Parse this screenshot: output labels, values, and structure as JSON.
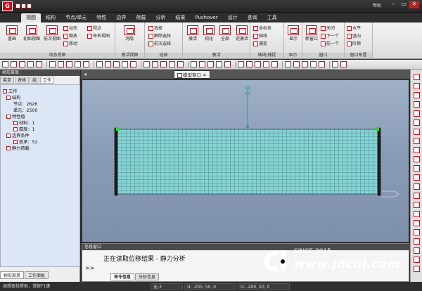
{
  "app": {
    "logo_text": "G",
    "help_label": "帮助",
    "menu_tabs": [
      "视图",
      "结构",
      "节点/单元",
      "特性",
      "边界",
      "荷载",
      "分析",
      "结果",
      "Pushover",
      "设计",
      "查询",
      "工具"
    ],
    "window_buttons": [
      "–",
      "▭",
      "✕"
    ]
  },
  "ribbon": {
    "groups": [
      {
        "label": "动态视图",
        "buttons": [
          "重画",
          "初始视图",
          "前次视图"
        ],
        "small": [
          "动态",
          "缩放",
          "移动",
          "视点",
          "命名视图"
        ]
      },
      {
        "label": "激活视图",
        "buttons": [
          "消隐"
        ]
      },
      {
        "label": "选择",
        "small": [
          "选择",
          "解除选择",
          "前次选择"
        ]
      },
      {
        "label": "激活",
        "buttons": [
          "激活",
          "钝化",
          "全部",
          "逆激活"
        ]
      },
      {
        "label": "轴线/捕捉",
        "small": [
          "坐标系",
          "轴线",
          "捕捉"
        ]
      },
      {
        "label": "显示",
        "buttons": [
          "显示"
        ]
      },
      {
        "label": "窗口",
        "buttons": [
          "新窗口"
        ],
        "small": [
          "关闭",
          "下一个",
          "前一个"
        ]
      },
      {
        "label": "窗口布置",
        "small": [
          "水平",
          "竖向",
          "阶梯"
        ]
      }
    ]
  },
  "left_panel": {
    "title": "树形菜单",
    "tabs": [
      "菜单",
      "表格",
      "组",
      "工作"
    ],
    "active_tab": "工作",
    "tree": [
      {
        "label": "工作",
        "level": 0
      },
      {
        "label": "结构",
        "level": 1
      },
      {
        "label": "节点：2626",
        "level": 2
      },
      {
        "label": "单元：2500",
        "level": 2
      },
      {
        "label": "特性值",
        "level": 1
      },
      {
        "label": "材料：1",
        "level": 2
      },
      {
        "label": "厚度：1",
        "level": 2
      },
      {
        "label": "边界条件",
        "level": 1
      },
      {
        "label": "支承：52",
        "level": 2
      },
      {
        "label": "静力荷载",
        "level": 1
      }
    ],
    "bottom_tabs": [
      "树形菜单",
      "工作面板"
    ]
  },
  "model_window": {
    "tab_label": "模型窗口",
    "load_label": "-1.0",
    "colors": {
      "mesh_fill": "#86d3d3",
      "mesh_line": "#1d4f5a",
      "support": "#1a1a1a",
      "node_green": "#22dd22"
    }
  },
  "info_window": {
    "title": "信息窗口",
    "text": "正在读取位移结果 - 静力分析",
    "prompt": ">>",
    "tabs": [
      "命令信息",
      "分析信息"
    ],
    "active_tab": "命令信息"
  },
  "status_bar": {
    "help_text": "如想查找帮助，请按F1键",
    "unit": "无-3",
    "coord_u": "U: -200, 50, 0",
    "coord_g": "G: -200, 50, 0"
  },
  "watermark": {
    "since": "SINCE 2015",
    "url": "www.jdcui.com"
  }
}
